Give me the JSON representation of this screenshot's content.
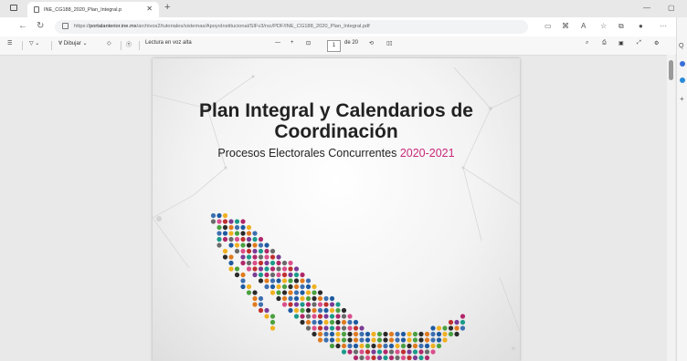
{
  "browser": {
    "tab_title": "INE_CG188_2020_Plan_Integral.p",
    "url_prefix": "https://",
    "url_host": "portalanterior.ine.mx",
    "url_path": "/archivos2/tutoriales/sistemas/ApoyoInstitucional/SIFv3/rsc/PDF/INE_CG188_2020_Plan_Integral.pdf"
  },
  "pdf_toolbar": {
    "draw_label": "Dibujar",
    "read_aloud_label": "Lectura en voz alta",
    "page_current": "1",
    "page_total": "de 20"
  },
  "document": {
    "title_line1": "Plan Integral y Calendarios de",
    "title_line2": "Coordinación",
    "subtitle_text": "Procesos Electorales Concurrentes",
    "subtitle_years": "2020-2021"
  },
  "colors": {
    "accent_pink": "#c8287a"
  }
}
